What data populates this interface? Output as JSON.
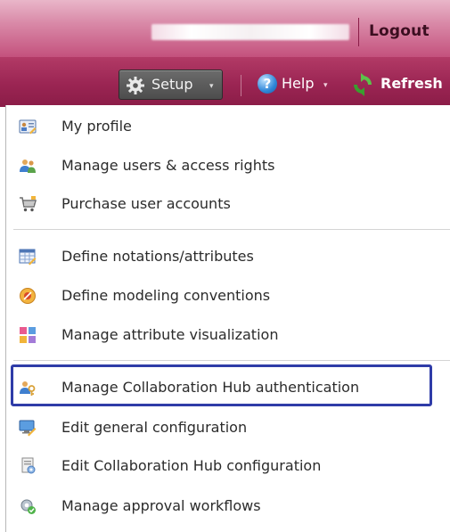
{
  "header": {
    "logout_label": "Logout"
  },
  "toolbar": {
    "setup_label": "Setup",
    "help_label": "Help",
    "refresh_label": "Refresh",
    "caret": "▾"
  },
  "menu": {
    "groups": [
      [
        {
          "label": "My profile",
          "icon": "profile-card-icon"
        },
        {
          "label": "Manage users & access rights",
          "icon": "users-icon"
        },
        {
          "label": "Purchase user accounts",
          "icon": "cart-icon"
        }
      ],
      [
        {
          "label": "Define notations/attributes",
          "icon": "table-edit-icon"
        },
        {
          "label": "Define modeling conventions",
          "icon": "conventions-icon"
        },
        {
          "label": "Manage attribute visualization",
          "icon": "color-grid-icon"
        }
      ],
      [
        {
          "label": "Manage Collaboration Hub authentication",
          "icon": "hub-auth-icon",
          "highlighted": true
        },
        {
          "label": "Edit general configuration",
          "icon": "monitor-edit-icon"
        },
        {
          "label": "Edit Collaboration Hub configuration",
          "icon": "hub-config-icon"
        },
        {
          "label": "Manage approval workflows",
          "icon": "workflow-gear-icon"
        }
      ]
    ]
  },
  "colors": {
    "header_top": "#e9b6c9",
    "header_bottom": "#c4517d",
    "toolbar": "#9b2553",
    "setup_button": "#555555",
    "highlight_border": "#2f3ca8"
  }
}
